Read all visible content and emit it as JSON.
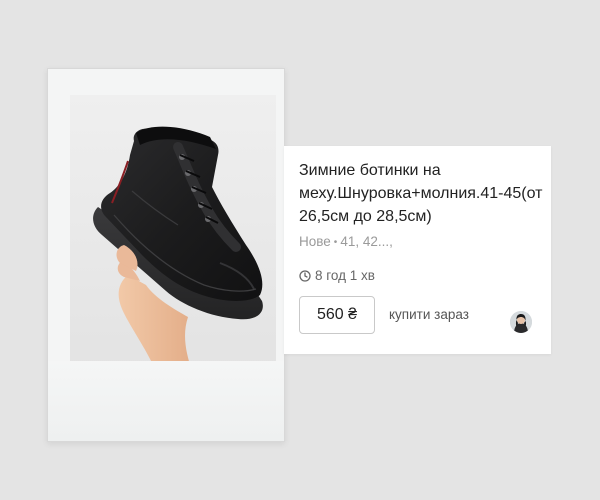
{
  "product": {
    "title": "Зимние ботинки на меху.Шнуровка+молния.41-45(от 26,5см до 28,5см)",
    "condition": "Нове",
    "sizes": "41, 42...,",
    "time_ago": "8 год 1 хв",
    "price": "560 ₴",
    "buy_label": "купити зараз"
  },
  "icons": {
    "clock": "clock-icon",
    "avatar": "seller-avatar"
  },
  "colors": {
    "background": "#e4e4e4",
    "card": "#ffffff",
    "muted_text": "#9a9a9a"
  }
}
